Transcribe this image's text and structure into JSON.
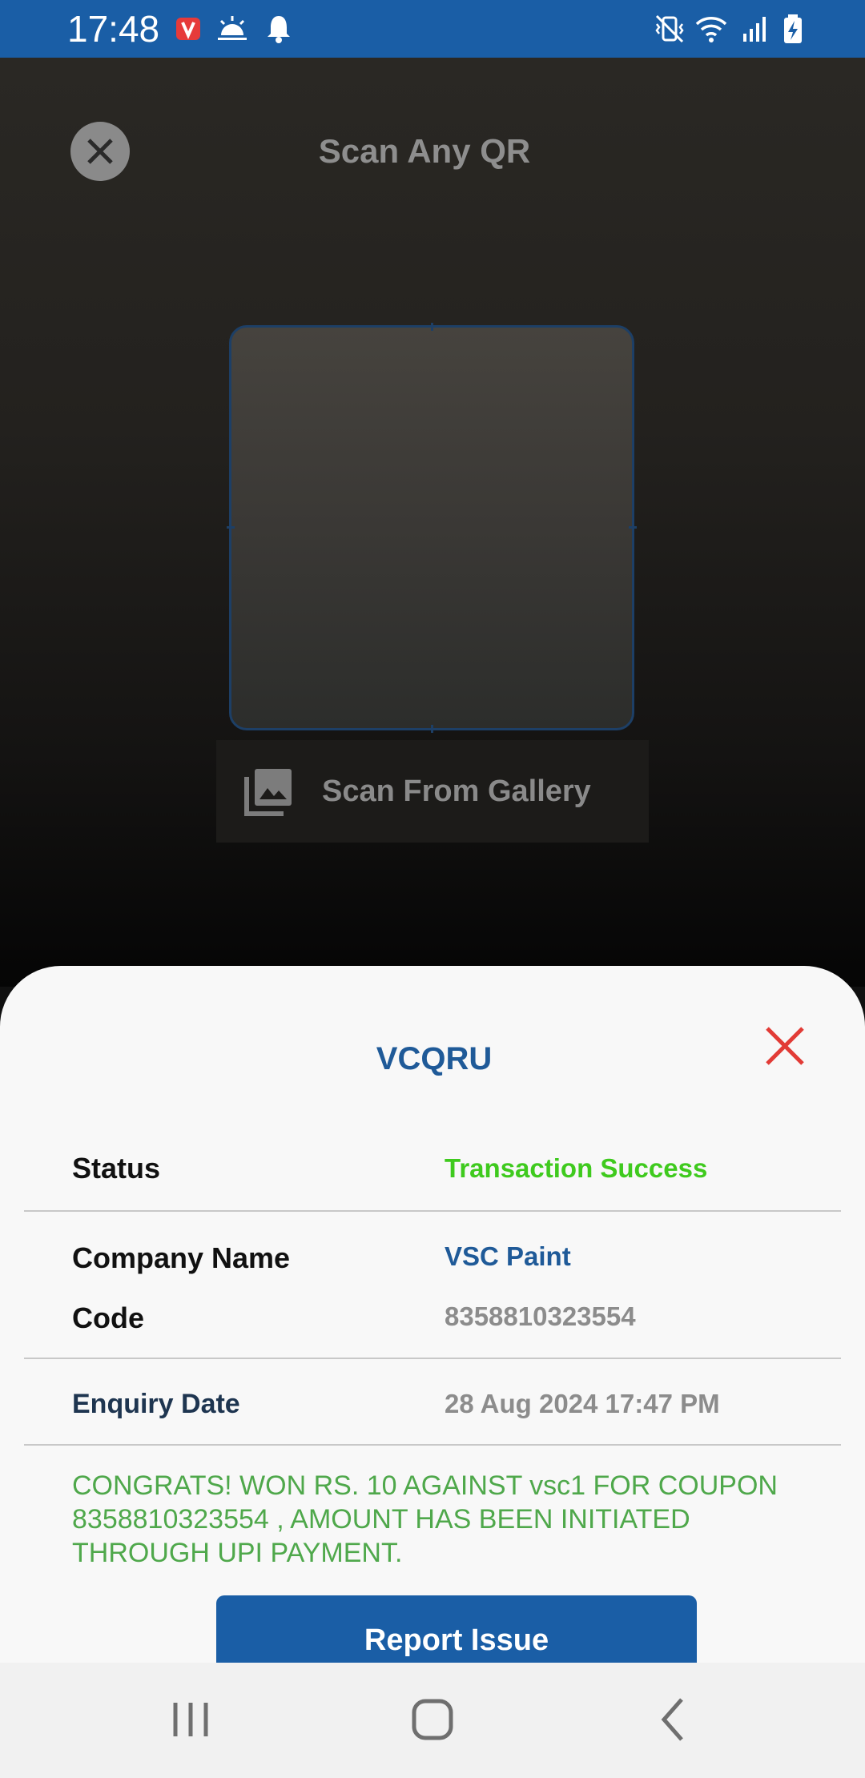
{
  "status_bar": {
    "time": "17:48",
    "icons_left": [
      "app-notification-icon",
      "weather-icon",
      "bell-icon"
    ],
    "icons_right": [
      "mute-vibrate-icon",
      "wifi-icon",
      "signal-icon",
      "battery-charging-icon"
    ],
    "color": "#1a5ea6"
  },
  "scanner": {
    "title": "Scan Any QR",
    "close_icon": "close-icon",
    "gallery_label": "Scan From Gallery",
    "gallery_icon": "gallery-icon"
  },
  "sheet": {
    "title": "VCQRU",
    "close_icon": "close-icon",
    "rows": {
      "status_label": "Status",
      "status_value": "Transaction Success",
      "company_label": "Company Name",
      "company_value": "VSC Paint",
      "code_label": "Code",
      "code_value": "8358810323554",
      "enquiry_label": "Enquiry Date",
      "enquiry_value": "28 Aug 2024 17:47 PM"
    },
    "message": "CONGRATS! WON RS. 10 AGAINST vsc1 FOR COUPON 8358810323554 , AMOUNT HAS BEEN INITIATED THROUGH UPI PAYMENT.",
    "report_button": "Report Issue",
    "colors": {
      "success": "#3fca1e",
      "accent": "#1f5a98",
      "message": "#4fa84b",
      "close": "#e23b36"
    }
  },
  "nav_bar": {
    "icons": [
      "recent-apps-icon",
      "home-icon",
      "back-icon"
    ]
  }
}
